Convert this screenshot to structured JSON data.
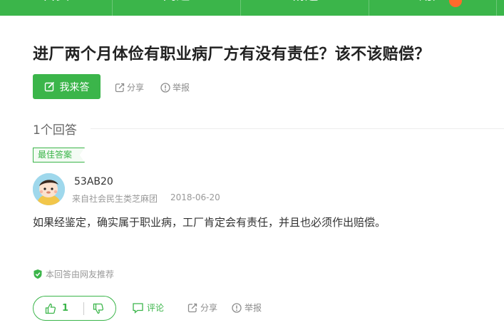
{
  "nav": {
    "items": [
      {
        "label": "首页"
      },
      {
        "label": "问题"
      },
      {
        "label": "精选"
      },
      {
        "label": "用户"
      }
    ],
    "bg_color": "#3bb54a",
    "badge_color": "#ff6a2c"
  },
  "question": {
    "title": "进厂两个月体俭有职业病厂方有没有责任？该不该赔偿？",
    "answer_button": "我来答",
    "share_label": "分享",
    "report_label": "举报"
  },
  "answers": {
    "count_label": "1个回答",
    "best_badge": "最佳答案",
    "user": {
      "name": "53AB20",
      "source": "来自社会民生类芝麻团",
      "date": "2018-06-20"
    },
    "body": "如果经鉴定，确实属于职业病，工厂肯定会有责任，并且也必须作出赔偿。",
    "recommend_label": "本回答由网友推荐",
    "likes": "1",
    "comment_label": "评论",
    "share_label": "分享",
    "report_label": "举报"
  },
  "icons": {
    "edit": "edit-icon",
    "share": "share-icon",
    "report": "report-icon",
    "shield": "shield-check-icon",
    "thumbs_up": "thumbs-up-icon",
    "thumbs_down": "thumbs-down-icon",
    "comment": "comment-icon"
  },
  "colors": {
    "accent": "#3bb54a",
    "muted": "#8c8c8c"
  }
}
